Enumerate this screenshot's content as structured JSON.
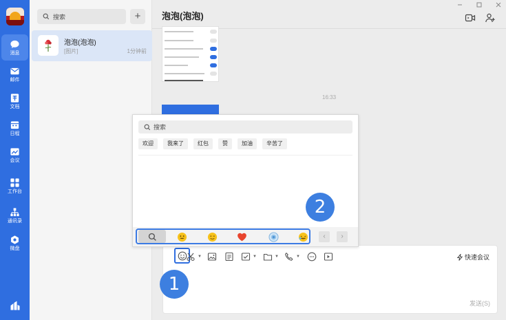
{
  "rail": {
    "items": [
      {
        "label": "消息",
        "icon": "chat-bubble-icon"
      },
      {
        "label": "邮件",
        "icon": "mail-icon"
      },
      {
        "label": "文档",
        "icon": "document-icon"
      },
      {
        "label": "日程",
        "icon": "calendar-icon"
      },
      {
        "label": "会议",
        "icon": "meeting-icon"
      },
      {
        "label": "工作台",
        "icon": "workbench-icon"
      },
      {
        "label": "通讯录",
        "icon": "contacts-icon"
      },
      {
        "label": "微盘",
        "icon": "drive-icon"
      }
    ]
  },
  "list": {
    "search_placeholder": "搜索",
    "add_label": "+",
    "conversation": {
      "name": "泡泡(泡泡)",
      "preview": "[图片]",
      "time": "1分钟前"
    }
  },
  "chat": {
    "title": "泡泡(泡泡)",
    "timestamp": "16:33",
    "quick_meeting": "快速会议",
    "send_label": "发送(S)"
  },
  "emoji_panel": {
    "search_placeholder": "搜索",
    "quick_phrases": [
      "欢迎",
      "我来了",
      "红包",
      "赞",
      "加油",
      "辛苦了"
    ],
    "prev_arrow": "‹",
    "next_arrow": "›"
  },
  "annotations": {
    "badge_1": "1",
    "badge_2": "2"
  },
  "colors": {
    "accent": "#2f6ee0",
    "toggle_on": "#2f6ee0",
    "badge": "#3d7fe0"
  }
}
